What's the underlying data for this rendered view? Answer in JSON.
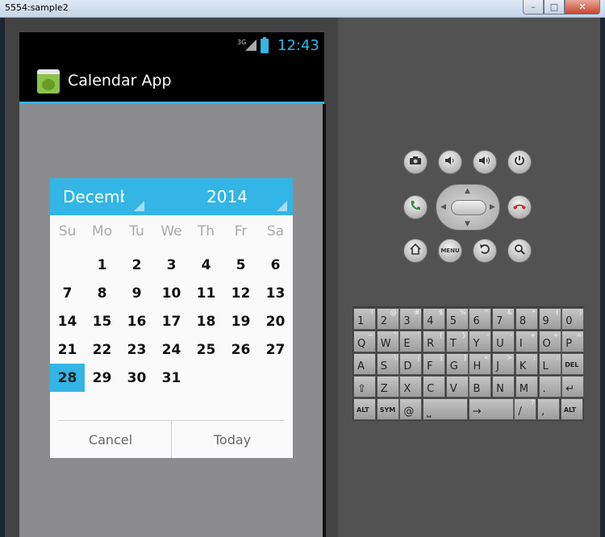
{
  "window": {
    "title": "5554:sample2",
    "controls": [
      "–",
      "□",
      "✕"
    ]
  },
  "status_bar": {
    "network": "3G",
    "time": "12:43"
  },
  "action_bar": {
    "title": "Calendar App"
  },
  "dialog": {
    "month": "December",
    "year": "2014",
    "weekdays": [
      "Su",
      "Mo",
      "Tu",
      "We",
      "Th",
      "Fr",
      "Sa"
    ],
    "weeks": [
      [
        "",
        "1",
        "2",
        "3",
        "4",
        "5",
        "6"
      ],
      [
        "7",
        "8",
        "9",
        "10",
        "11",
        "12",
        "13"
      ],
      [
        "14",
        "15",
        "16",
        "17",
        "18",
        "19",
        "20"
      ],
      [
        "21",
        "22",
        "23",
        "24",
        "25",
        "26",
        "27"
      ],
      [
        "28",
        "29",
        "30",
        "31",
        "",
        "",
        ""
      ]
    ],
    "selected_day": "28",
    "buttons": {
      "cancel": "Cancel",
      "today": "Today"
    }
  },
  "hardware_buttons": {
    "camera": "camera-icon",
    "volume_down": "volume-down-icon",
    "volume_up": "volume-up-icon",
    "power": "power-icon",
    "call": "call-icon",
    "end_call": "end-call-icon",
    "home": "home-icon",
    "menu": "MENU",
    "back": "back-icon",
    "search": "search-icon"
  },
  "keyboard": {
    "rows": [
      [
        [
          "1",
          "!"
        ],
        [
          "2",
          "@"
        ],
        [
          "3",
          "#"
        ],
        [
          "4",
          "$"
        ],
        [
          "5",
          "%"
        ],
        [
          "6",
          "^"
        ],
        [
          "7",
          "&"
        ],
        [
          "8",
          "*"
        ],
        [
          "9",
          "("
        ],
        [
          "0",
          ")"
        ]
      ],
      [
        [
          "Q",
          "~"
        ],
        [
          "W",
          "\""
        ],
        [
          "E",
          "`"
        ],
        [
          "R",
          "{"
        ],
        [
          "T",
          "}"
        ],
        [
          "Y",
          "-"
        ],
        [
          "U",
          "-"
        ],
        [
          "I",
          "+"
        ],
        [
          "O",
          "+"
        ],
        [
          "P",
          "="
        ]
      ],
      [
        [
          "A",
          ""
        ],
        [
          "S",
          "\\"
        ],
        [
          "D",
          "|"
        ],
        [
          "F",
          "["
        ],
        [
          "G",
          "]"
        ],
        [
          "H",
          "<"
        ],
        [
          "J",
          ">"
        ],
        [
          "K",
          ";"
        ],
        [
          "L",
          ":"
        ],
        [
          "DEL",
          ""
        ]
      ],
      [
        [
          "⇧",
          ""
        ],
        [
          "Z",
          ""
        ],
        [
          "X",
          ""
        ],
        [
          "C",
          ""
        ],
        [
          "V",
          ""
        ],
        [
          "B",
          ""
        ],
        [
          "N",
          ""
        ],
        [
          "M",
          ""
        ],
        [
          ".",
          ""
        ],
        [
          "↵",
          ""
        ]
      ],
      [
        [
          "ALT",
          ""
        ],
        [
          "SYM",
          ""
        ],
        [
          "@",
          ""
        ],
        [
          "",
          ""
        ],
        [
          "⎵",
          ""
        ],
        [
          "",
          ""
        ],
        [
          "→",
          ""
        ],
        [
          "/",
          "?"
        ],
        [
          ",",
          ""
        ],
        [
          "ALT",
          ""
        ]
      ]
    ]
  },
  "colors": {
    "accent": "#33b5e5",
    "call_green": "#2e8b3a",
    "end_red": "#c0392b"
  }
}
